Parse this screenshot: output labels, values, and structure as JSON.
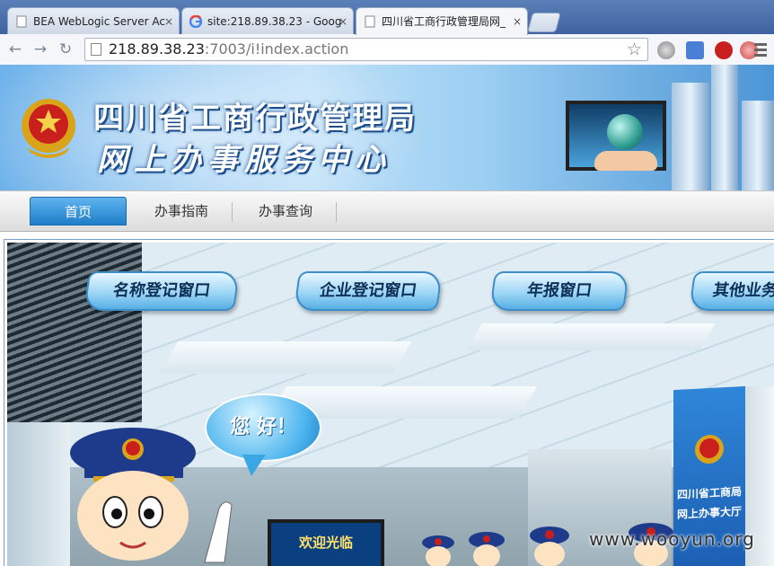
{
  "browser": {
    "tabs": [
      {
        "label": "BEA WebLogic Server Ac",
        "close": "×"
      },
      {
        "label": "site:218.89.38.23 - Goog",
        "close": "×"
      },
      {
        "label": "四川省工商行政管理局网_",
        "close": "×"
      }
    ],
    "url_host": "218.89.38.23",
    "url_rest": ":7003/i!index.action",
    "star": "☆",
    "nav": {
      "back": "←",
      "forward": "→",
      "reload": "↻"
    }
  },
  "site": {
    "title_line1": "四川省工商行政管理局",
    "title_line2": "网上办事服务中心",
    "nav_items": [
      "首页",
      "办事指南",
      "办事查询"
    ],
    "windows": [
      "名称登记窗口",
      "企业登记窗口",
      "年报窗口",
      "其他业务"
    ],
    "greeting": "您 好！",
    "hall_sign_line1": "四川省工商局",
    "hall_sign_line2": "网上办事大厅",
    "welcome_screen": "欢迎光临"
  },
  "watermark": "www.wooyun.org",
  "colors": {
    "accent": "#1f7ec8",
    "banner": "#8fc8f0",
    "uniform": "#1e3a8a"
  }
}
